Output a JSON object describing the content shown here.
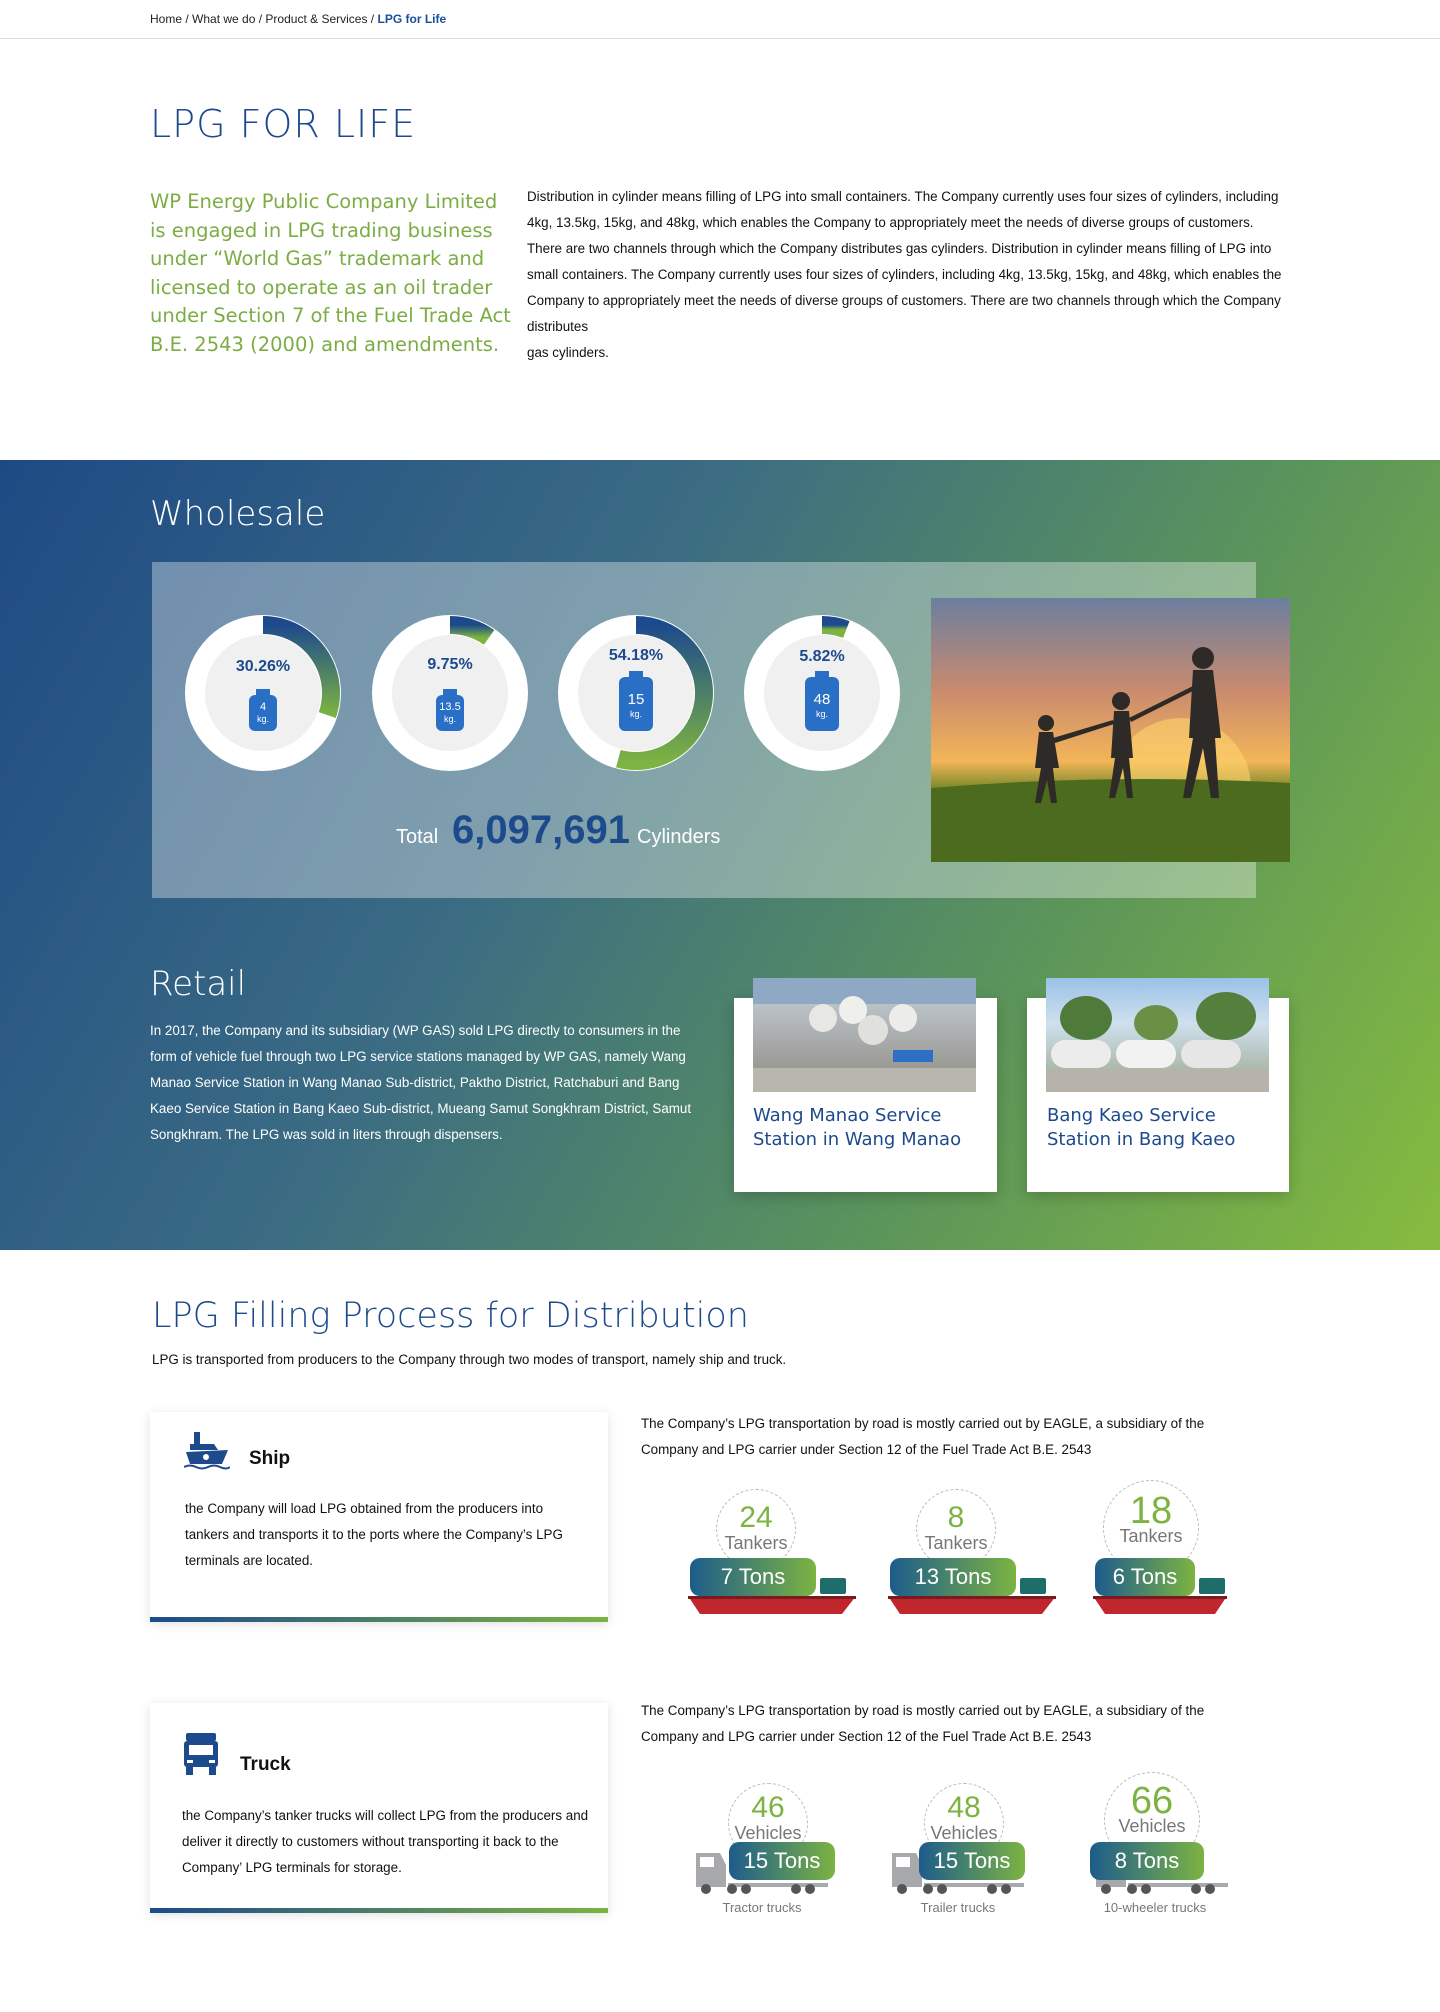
{
  "breadcrumb": {
    "home": "Home",
    "sep": " / ",
    "what": "What we do",
    "products": "Product & Services",
    "current": "LPG for Life"
  },
  "page_title": "LPG FOR LIFE",
  "lead": "WP Energy Public Company Limited is engaged in LPG trading business under “World Gas” trademark and licensed to operate as an oil trader under Section 7 of the Fuel Trade Act B.E. 2543 (2000) and amendments.",
  "intro": "Distribution in cylinder means filling of LPG into small containers. The Company currently uses four sizes of cylinders, including 4kg, 13.5kg, 15kg, and 48kg, which enables the Company to appropriately meet the needs of diverse groups of customers. There are two channels through which the Company distributes gas cylinders. Distribution in cylinder means filling of LPG into small containers. The Company currently uses four sizes of cylinders, including 4kg, 13.5kg, 15kg, and 48kg, which enables the Company to appropriately meet the needs of diverse groups of customers. There are two channels through which the Company distributes",
  "intro_end": "gas cylinders.",
  "wholesale": {
    "title": "Wholesale",
    "cylinders": [
      {
        "pct": "30.26%",
        "value": 30.26,
        "size": "4",
        "unit": "kg."
      },
      {
        "pct": "9.75%",
        "value": 9.75,
        "size": "13.5",
        "unit": "kg."
      },
      {
        "pct": "54.18%",
        "value": 54.18,
        "size": "15",
        "unit": "kg."
      },
      {
        "pct": "5.82%",
        "value": 5.82,
        "size": "48",
        "unit": "kg."
      }
    ],
    "total_label": "Total",
    "total_value": "6,097,691",
    "total_unit": "Cylinders"
  },
  "retail": {
    "title": "Retail",
    "text": "In 2017, the Company and its subsidiary (WP GAS) sold LPG directly to consumers in the form of vehicle fuel through two LPG service stations managed by WP GAS, namely Wang Manao Service Station in Wang Manao Sub-district, Paktho District, Ratchaburi and Bang Kaeo Service Station in Bang Kaeo Sub-district, Mueang Samut Songkhram District, Samut Songkhram. The LPG was sold in liters through dispensers.",
    "stations": [
      {
        "name": "Wang Manao Service Station in Wang Manao"
      },
      {
        "name": "Bang Kaeo Service Station in Bang Kaeo"
      }
    ]
  },
  "filling": {
    "title": "LPG Filling Process for Distribution",
    "subtitle": "LPG is transported from producers to the Company through two modes of transport, namely ship and truck.",
    "ship": {
      "heading": "Ship",
      "text": "the Company will load LPG obtained from the producers into tankers and transports it to the ports where the Company’s LPG terminals are located.",
      "right_text": "The Company’s LPG transportation by road is mostly carried out by EAGLE, a subsidiary of the Company and LPG carrier under Section 12 of the Fuel Trade Act B.E. 2543",
      "items": [
        {
          "count": "24",
          "unit": "Tankers",
          "capacity": "7 Tons"
        },
        {
          "count": "8",
          "unit": "Tankers",
          "capacity": "13 Tons"
        },
        {
          "count": "18",
          "unit": "Tankers",
          "capacity": "6 Tons"
        }
      ]
    },
    "truck": {
      "heading": "Truck",
      "text": "the Company’s tanker trucks will collect LPG from the producers and deliver it directly to customers without transporting it back to the Company’ LPG terminals for storage.",
      "right_text": "The Company’s LPG transportation by road is mostly carried out by EAGLE, a subsidiary of the Company and LPG carrier under Section 12 of the Fuel Trade Act B.E. 2543",
      "items": [
        {
          "count": "46",
          "unit": "Vehicles",
          "capacity": "15 Tons",
          "caption": "Tractor trucks"
        },
        {
          "count": "48",
          "unit": "Vehicles",
          "capacity": "15 Tons",
          "caption": "Trailer trucks"
        },
        {
          "count": "66",
          "unit": "Vehicles",
          "capacity": "8 Tons",
          "caption": "10-wheeler trucks"
        }
      ]
    }
  }
}
